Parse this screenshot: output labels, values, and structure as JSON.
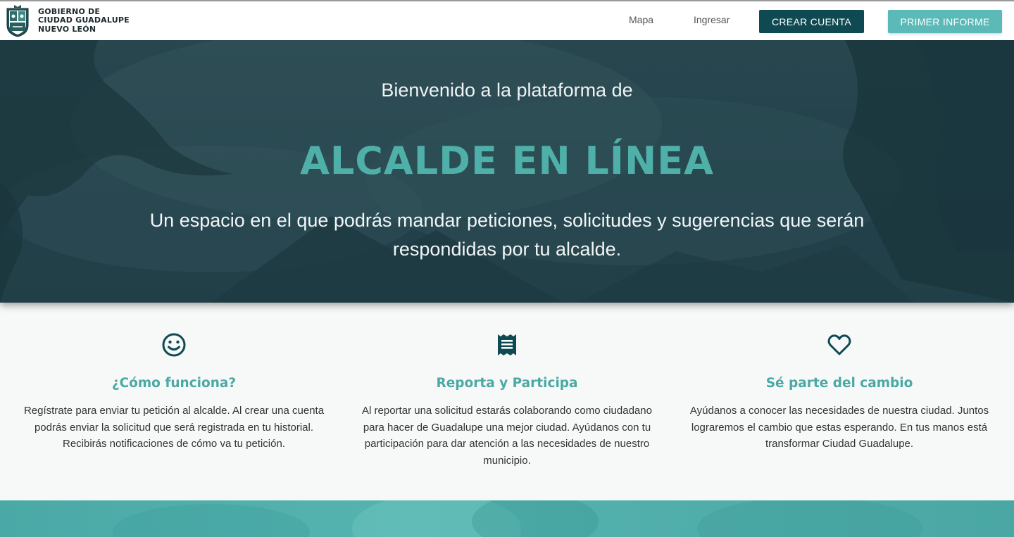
{
  "brand": {
    "line1": "GOBIERNO DE",
    "line2": "CIUDAD GUADALUPE",
    "line3": "NUEVO LEÓN",
    "crest_icon": "shield-crest-icon"
  },
  "nav": {
    "map_label": "Mapa",
    "login_label": "Ingresar",
    "create_account_label": "CREAR CUENTA",
    "first_report_label": "PRIMER INFORME"
  },
  "hero": {
    "pre_title": "Bienvenido a la plataforma de",
    "title": "ALCALDE EN LÍNEA",
    "description": "Un espacio en el que podrás mandar peticiones, solicitudes y sugerencias que serán respondidas por tu alcalde."
  },
  "features": [
    {
      "icon": "smiley-icon",
      "title": "¿Cómo funciona?",
      "text": "Regístrate para enviar tu petición al alcalde. Al crear una cuenta podrás enviar la solicitud que será registrada en tu historial. Recibirás notificaciones de cómo va tu petición."
    },
    {
      "icon": "receipt-icon",
      "title": "Reporta y Participa",
      "text": "Al reportar una solicitud estarás colaborando como ciudadano para hacer de Guadalupe una mejor ciudad. Ayúdanos con tu participación para dar atención a las necesidades de nuestro municipio."
    },
    {
      "icon": "heart-icon",
      "title": "Sé parte del cambio",
      "text": "Ayúdanos a conocer las necesidades de nuestra ciudad. Juntos lograremos el cambio que estas esperando. En tus manos está transformar Ciudad Guadalupe."
    }
  ],
  "colors": {
    "primary_dark": "#0f4a52",
    "accent_teal": "#5bbab8",
    "title_teal": "#4fb0a9",
    "icon_dark": "#0f4a52"
  }
}
